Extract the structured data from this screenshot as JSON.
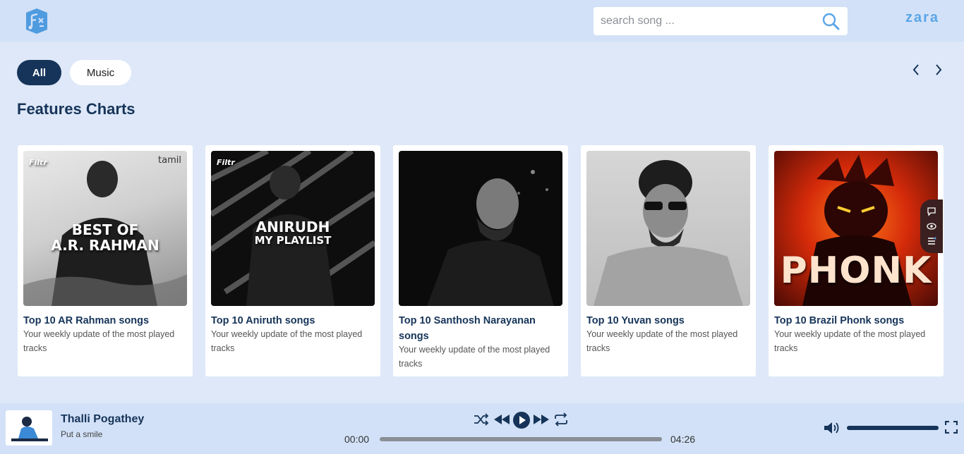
{
  "header": {
    "user_name": "zara",
    "search": {
      "placeholder": "search song ...",
      "value": ""
    }
  },
  "filters": {
    "all_label": "All",
    "music_label": "Music"
  },
  "section": {
    "title": "Features Charts"
  },
  "cards": [
    {
      "title": "Top 10 AR Rahman songs",
      "desc": "Your weekly update of the most played tracks",
      "art_line1": "BEST OF",
      "art_line2": "A.R. RAHMAN",
      "badge_left": "Filtr",
      "badge_right": "tamil"
    },
    {
      "title": "Top 10 Aniruth songs",
      "desc": "Your weekly update of the most played tracks",
      "art_line1": "ANIRUDH",
      "art_line2": "MY PLAYLIST",
      "badge_left": "Filtr"
    },
    {
      "title": "Top 10 Santhosh Narayanan songs",
      "desc": "Your weekly update of the most played tracks"
    },
    {
      "title": "Top 10 Yuvan songs",
      "desc": "Your weekly update of the most played tracks"
    },
    {
      "title": "Top 10 Brazil Phonk songs",
      "desc": "Your weekly update of the most played tracks",
      "art_line1": "PHONK"
    }
  ],
  "player": {
    "title": "Thalli Pogathey",
    "subtitle": "Put a smile",
    "current_time": "00:00",
    "total_time": "04:26",
    "progress": 0,
    "volume": 1
  },
  "colors": {
    "accent": "#163459",
    "header_bg": "#d2e1f7",
    "page_bg": "#dee8f8",
    "logo": "#5aa6e6"
  }
}
